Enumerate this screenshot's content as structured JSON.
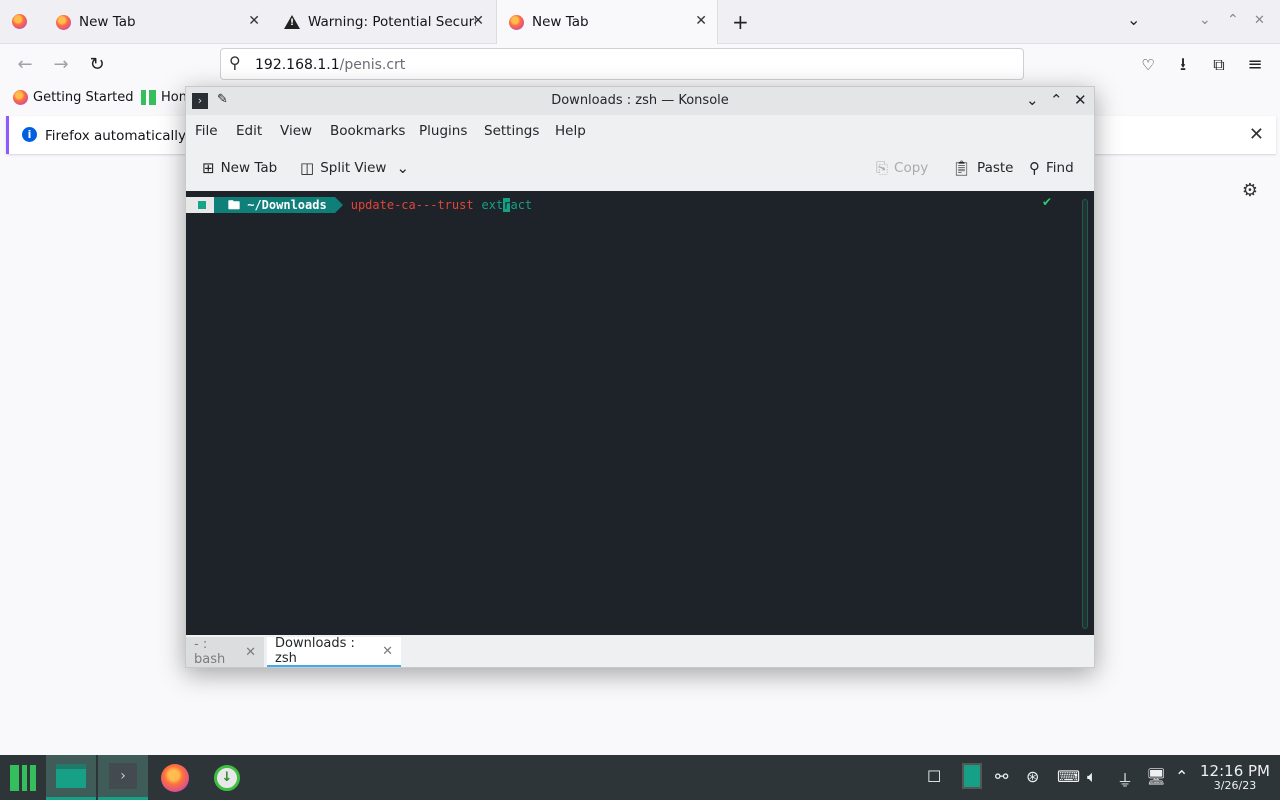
{
  "firefox": {
    "tabs": [
      {
        "label": "New Tab",
        "icon": "firefox-icon"
      },
      {
        "label": "Warning: Potential Security Risk Ahead",
        "icon": "warning-icon"
      },
      {
        "label": "New Tab",
        "icon": "firefox-icon",
        "active": true
      }
    ],
    "url": {
      "host": "192.168.1.1",
      "path": "/penis.crt"
    },
    "bookmarks": [
      {
        "label": "Getting Started",
        "icon": "firefox-icon"
      },
      {
        "label": "Hon",
        "icon": "manjaro-icon"
      }
    ],
    "infobar": {
      "text": "Firefox automatically s"
    }
  },
  "konsole": {
    "title": "Downloads : zsh — Konsole",
    "menu": [
      "File",
      "Edit",
      "View",
      "Bookmarks",
      "Plugins",
      "Settings",
      "Help"
    ],
    "toolbar": {
      "new_tab": "New Tab",
      "split_view": "Split View",
      "copy": "Copy",
      "paste": "Paste",
      "find": "Find"
    },
    "prompt": {
      "dir": "~/Downloads",
      "cmd_part1": "update-ca---trust",
      "cmd_part2a": "ext",
      "cmd_cursor": "r",
      "cmd_part2b": "act"
    },
    "session_tabs": [
      {
        "label": "- : bash"
      },
      {
        "label": "Downloads : zsh",
        "active": true
      }
    ]
  },
  "taskbar": {
    "time": "12:16 PM",
    "date": "3/26/23"
  },
  "colors": {
    "accent": "#16a085",
    "terminal_bg": "#1e232a",
    "command_error": "#e0453a"
  }
}
